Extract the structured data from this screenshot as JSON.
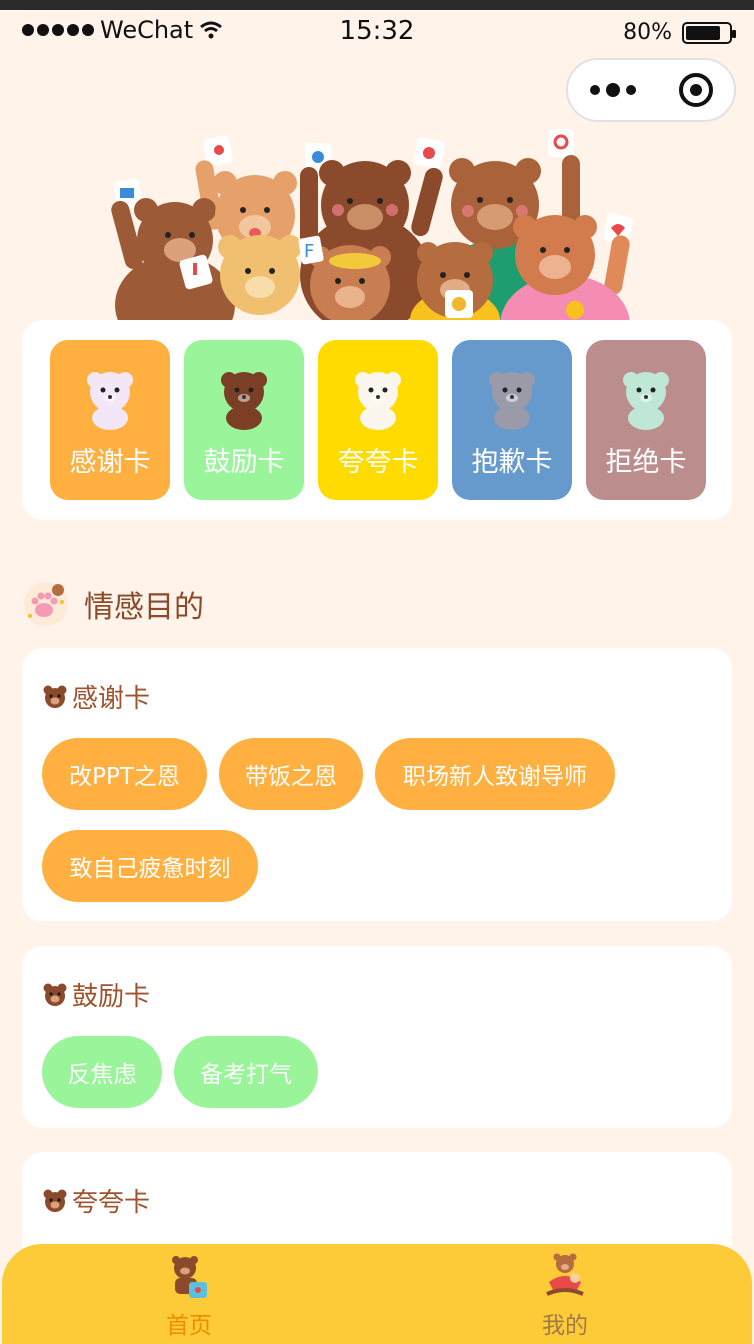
{
  "status_bar": {
    "carrier": "WeChat",
    "time": "15:32",
    "battery": "80%",
    "battery_level": 0.8
  },
  "cards": [
    {
      "label": "感谢卡",
      "color": "#FFB040",
      "bear": "#F3E6F7"
    },
    {
      "label": "鼓励卡",
      "color": "#9AF59A",
      "bear": "#7A3F25"
    },
    {
      "label": "夸夸卡",
      "color": "#FFDB00",
      "bear": "#FBF6EE"
    },
    {
      "label": "抱歉卡",
      "color": "#6699CC",
      "bear": "#9A9AA8"
    },
    {
      "label": "拒绝卡",
      "color": "#BC8D8D",
      "bear": "#BFE7D6"
    }
  ],
  "section": {
    "title": "情感目的"
  },
  "purposes": [
    {
      "title": "感谢卡",
      "tags": [
        "改PPT之恩",
        "带饭之恩",
        "职场新人致谢导师",
        "致自己疲惫时刻"
      ]
    },
    {
      "title": "鼓励卡",
      "tags": [
        "反焦虑",
        "备考打气"
      ]
    },
    {
      "title": "夸夸卡",
      "tags": []
    }
  ],
  "tabbar": {
    "items": [
      {
        "label": "首页",
        "active": true,
        "color": "#F08C00"
      },
      {
        "label": "我的",
        "active": false,
        "color": "#A07A48"
      }
    ]
  }
}
